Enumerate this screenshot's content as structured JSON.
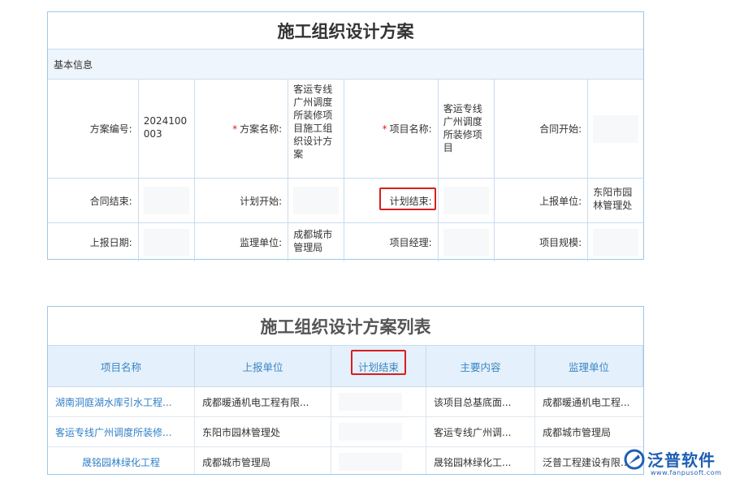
{
  "form": {
    "title": "施工组织设计方案",
    "section": "基本信息",
    "fields": {
      "plan_no_label": "方案编号:",
      "plan_no_value": "2024100003",
      "plan_name_label": "方案名称:",
      "plan_name_value": "客运专线广州调度所装修项目施工组织设计方案",
      "project_name_label": "项目名称:",
      "project_name_value": "客运专线广州调度所装修项目",
      "contract_start_label": "合同开始:",
      "contract_end_label": "合同结束:",
      "plan_start_label": "计划开始:",
      "plan_end_label": "计划结束:",
      "report_unit_label": "上报单位:",
      "report_unit_value": "东阳市园林管理处",
      "report_date_label": "上报日期:",
      "supervisor_label": "监理单位:",
      "supervisor_value": "成都城市管理局",
      "project_manager_label": "项目经理:",
      "project_scale_label": "项目规模:"
    },
    "required_mark": "*"
  },
  "list": {
    "title": "施工组织设计方案列表",
    "columns": [
      "项目名称",
      "上报单位",
      "计划结束",
      "主要内容",
      "监理单位"
    ],
    "rows": [
      {
        "project": "湖南洞庭湖水库引水工程...",
        "report_unit": "成都暖通机电工程有限...",
        "plan_end": "",
        "content": "该项目总基底面...",
        "supervisor": "成都暖通机电工程..."
      },
      {
        "project": "客运专线广州调度所装修...",
        "report_unit": "东阳市园林管理处",
        "plan_end": "",
        "content": "客运专线广州调...",
        "supervisor": "成都城市管理局"
      },
      {
        "project": "晟铭园林绿化工程",
        "report_unit": "成都城市管理局",
        "plan_end": "",
        "content": "晟铭园林绿化工...",
        "supervisor": "泛普工程建设有限..."
      }
    ]
  },
  "logo": {
    "name": "泛普软件",
    "url": "www.fanpusoft.com"
  },
  "colors": {
    "accent": "#3a86c4",
    "link": "#2f7fc7",
    "highlight": "#d81e1e",
    "header_bg": "#e4f0fb",
    "section_bg": "#eef5fc",
    "border": "#9ec7e6"
  }
}
